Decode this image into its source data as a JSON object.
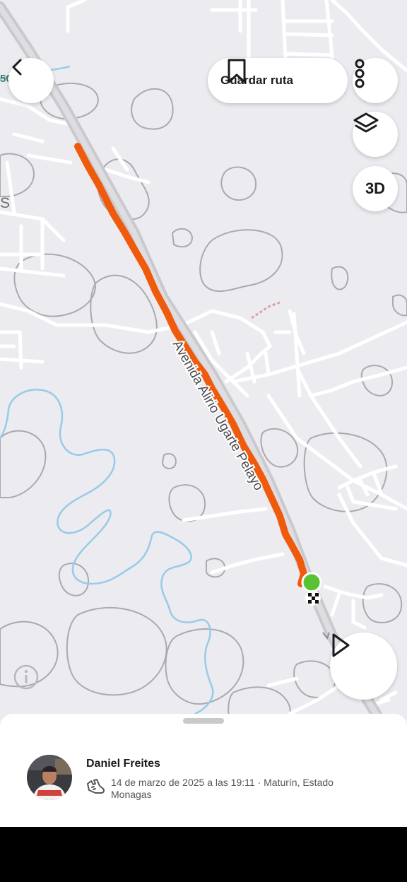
{
  "map": {
    "street_label": "Avenida Alirio Ugarte Pelayo",
    "edge_letter": "S",
    "edge_number": "50"
  },
  "top_bar": {
    "save_route_label": "Guardar ruta"
  },
  "map_controls": {
    "three_d_label": "3D"
  },
  "activity": {
    "athlete_name": "Daniel Freites",
    "details": "14 de marzo de 2025 a las 19:11 · Maturín, Estado Monagas",
    "activity_type_icon": "run-shoe-icon"
  },
  "colors": {
    "route": "#f05a0c",
    "start_marker": "#58c234",
    "water": "#97cbe9",
    "road_major": "#c9c9ce"
  }
}
